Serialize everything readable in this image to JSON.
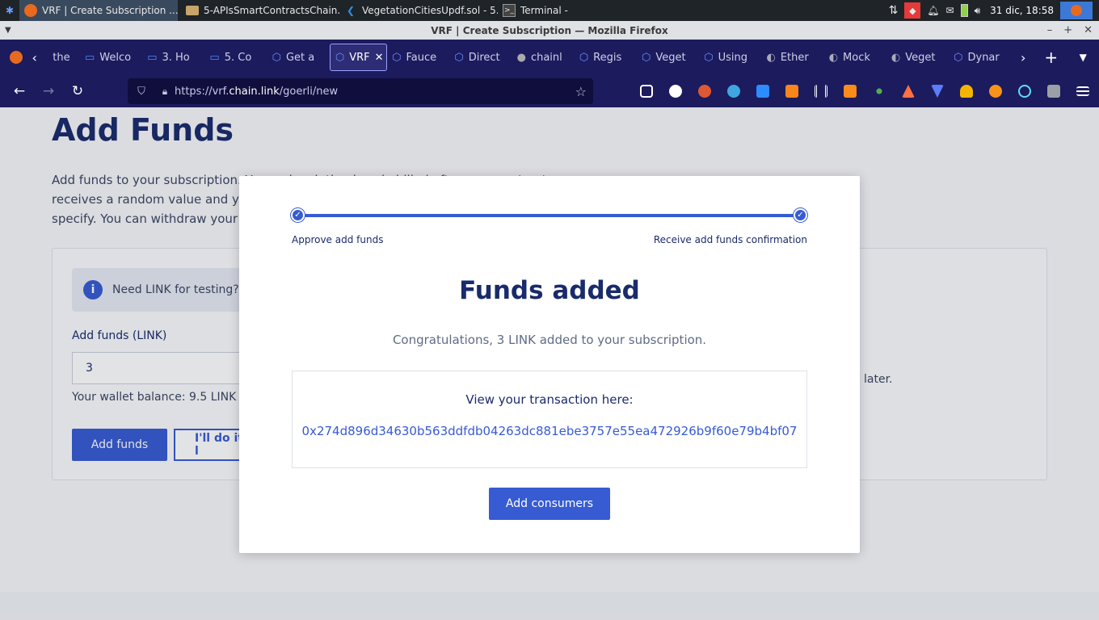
{
  "taskbar": {
    "windows": [
      {
        "label": "VRF | Create Subscription ...",
        "icon": "firefox-icon"
      },
      {
        "label": "5-APIsSmartContractsChain...",
        "icon": "folder-icon"
      },
      {
        "label": "VegetationCitiesUpdf.sol - 5...",
        "icon": "vscode-icon"
      },
      {
        "label": "Terminal -",
        "icon": "terminal-icon"
      }
    ],
    "clock": "31 dic, 18:58"
  },
  "window": {
    "title": "VRF | Create Subscription — Mozilla Firefox"
  },
  "tabs": [
    {
      "label": "the"
    },
    {
      "label": "Welco"
    },
    {
      "label": "3. Ho"
    },
    {
      "label": "5. Co"
    },
    {
      "label": "Get a"
    },
    {
      "label": "VRF"
    },
    {
      "label": "Fauce"
    },
    {
      "label": "Direct"
    },
    {
      "label": "chainl"
    },
    {
      "label": "Regis"
    },
    {
      "label": "Veget"
    },
    {
      "label": "Using"
    },
    {
      "label": "Ether"
    },
    {
      "label": "Mock"
    },
    {
      "label": "Veget"
    },
    {
      "label": "Dynar"
    }
  ],
  "nav": {
    "url_prefix": "https://vrf.",
    "url_domain": "chain.link",
    "url_path": "/goerli/new"
  },
  "page": {
    "title": "Add Funds",
    "para1": "Add funds to your subscription. Your subscription is only billed after your contract",
    "para2": "receives a random value and your",
    "para3": "specify. You can withdraw your f",
    "info": "Need LINK for testing? V",
    "input_label": "Add funds (LINK)",
    "input_value": "3",
    "balance": "Your wallet balance: 9.5 LINK",
    "add_funds": "Add funds",
    "do_later": "I'll do it l",
    "later": "later."
  },
  "modal": {
    "step1": "Approve add funds",
    "step2": "Receive add funds confirmation",
    "title": "Funds added",
    "subtitle": "Congratulations, 3 LINK added to your subscription.",
    "tx_label": "View your transaction here:",
    "tx_hash": "0x274d896d34630b563ddfdb04263dc881ebe3757e55ea472926b9f60e79b4bf07",
    "button": "Add consumers"
  },
  "colors": {
    "accent": "#375bd2",
    "navy": "#1a2b6b",
    "browser": "#1c1b5e"
  }
}
